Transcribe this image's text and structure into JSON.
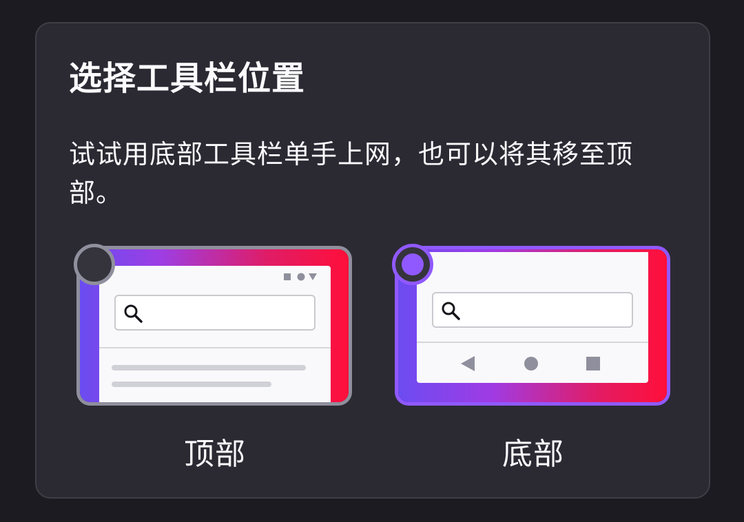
{
  "dialog": {
    "title": "选择工具栏位置",
    "description": "试试用底部工具栏单手上网，也可以将其移至顶部。"
  },
  "options": [
    {
      "label": "顶部",
      "selected": false
    },
    {
      "label": "底部",
      "selected": true
    }
  ],
  "colors": {
    "background": "#1c1b22",
    "card": "#2b2a33",
    "accent": "#9059ff",
    "unselected_border": "#8f8f9d",
    "text": "#fbfbfe"
  },
  "icons": {
    "search": "search-icon",
    "status_square": "square-icon",
    "status_circle": "circle-icon",
    "status_triangle": "triangle-icon",
    "nav_back": "back-triangle-icon",
    "nav_home": "home-circle-icon",
    "nav_recents": "recents-square-icon"
  }
}
